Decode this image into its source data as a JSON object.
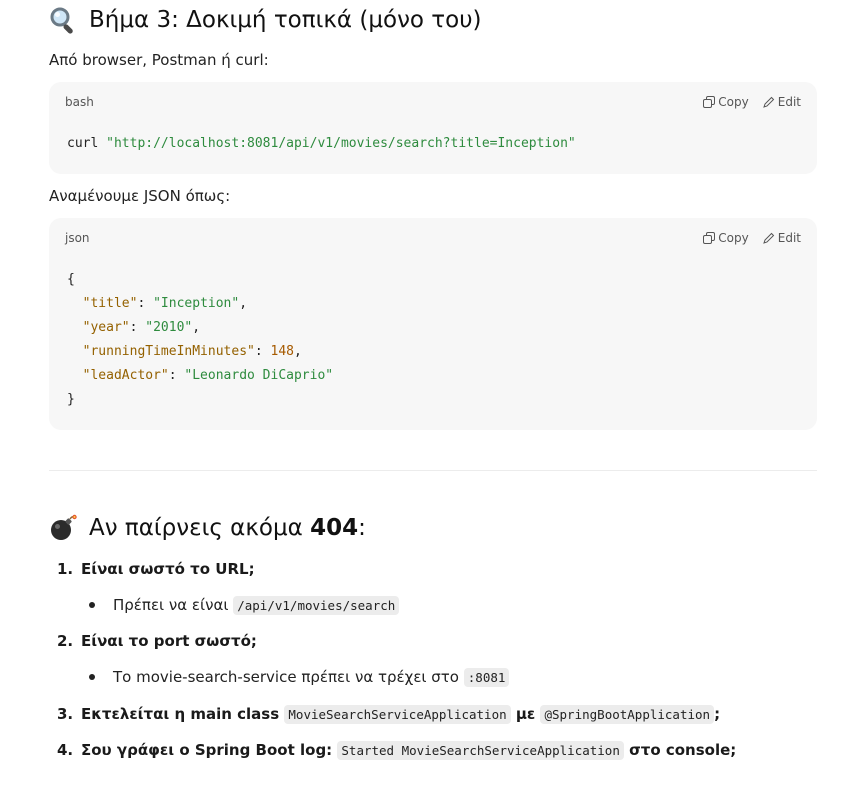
{
  "section1": {
    "icon": "magnifier-icon",
    "title": "Βήμα 3: Δοκιμή τοπικά (μόνο του)",
    "intro": "Από browser, Postman ή curl:",
    "code1": {
      "lang": "bash",
      "copy_label": "Copy",
      "edit_label": "Edit",
      "cmd": "curl",
      "url": "\"http://localhost:8081/api/v1/movies/search?title=Inception\""
    },
    "expect": "Αναμένουμε JSON όπως:",
    "code2": {
      "lang": "json",
      "copy_label": "Copy",
      "edit_label": "Edit",
      "open": "{",
      "close": "}",
      "lines": [
        {
          "key": "\"title\"",
          "value": "\"Inception\"",
          "sep": ","
        },
        {
          "key": "\"year\"",
          "value": "\"2010\"",
          "sep": ","
        },
        {
          "key": "\"runningTimeInMinutes\"",
          "value": "148",
          "sep": ","
        },
        {
          "key": "\"leadActor\"",
          "value": "\"Leonardo DiCaprio\"",
          "sep": ""
        }
      ]
    }
  },
  "section2": {
    "icon": "bomb-icon",
    "title_pre": "Αν παίρνεις ακόμα ",
    "title_bold": "404",
    "title_post": ":",
    "steps": [
      {
        "num": "1.",
        "text": "Είναι σωστό το URL;",
        "bullet_pre": "Πρέπει να είναι ",
        "bullet_code": "/api/v1/movies/search"
      },
      {
        "num": "2.",
        "text": "Είναι το port σωστό;",
        "bullet_pre": "Το movie-search-service πρέπει να τρέχει στο ",
        "bullet_code": ":8081"
      },
      {
        "num": "3.",
        "pre": "Εκτελείται η main class ",
        "code1": "MovieSearchServiceApplication",
        "mid": " με ",
        "code2": "@SpringBootApplication",
        "post": ";"
      },
      {
        "num": "4.",
        "pre": "Σου γράφει ο Spring Boot log: ",
        "code1": "Started MovieSearchServiceApplication",
        "post": " στο console;"
      }
    ]
  }
}
